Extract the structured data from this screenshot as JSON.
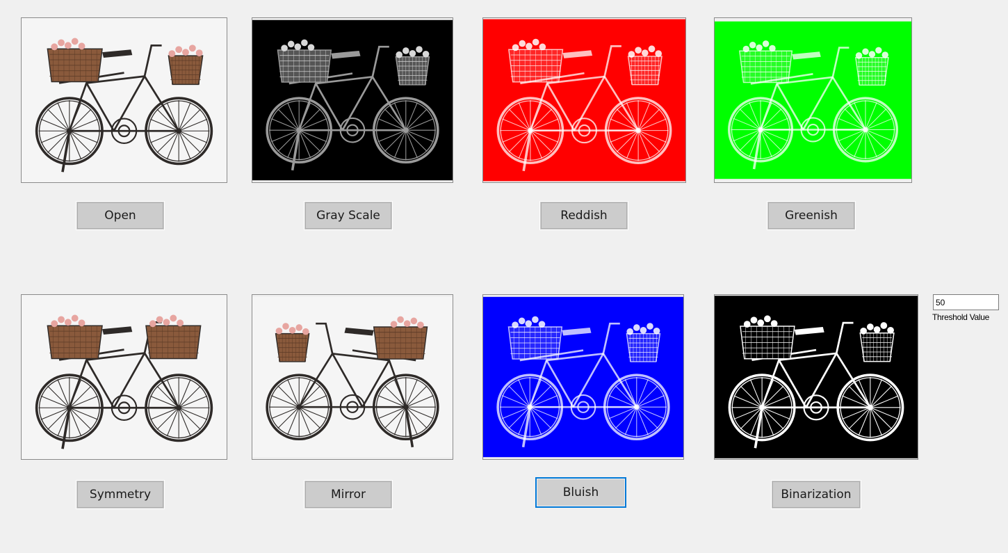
{
  "images": [
    {
      "name": "original",
      "filter": "original",
      "bg": "#f5f5f5"
    },
    {
      "name": "grayscale",
      "filter": "grayscale",
      "bg": "#000000"
    },
    {
      "name": "reddish",
      "filter": "tint",
      "bg": "#ff0000"
    },
    {
      "name": "greenish",
      "filter": "tint",
      "bg": "#00ff00"
    },
    {
      "name": "symmetry",
      "filter": "symmetry",
      "bg": "#f5f5f5"
    },
    {
      "name": "mirror",
      "filter": "mirror",
      "bg": "#f5f5f5"
    },
    {
      "name": "bluish",
      "filter": "tint",
      "bg": "#0000ff"
    },
    {
      "name": "binarization",
      "filter": "binary",
      "bg": "#000000"
    }
  ],
  "buttons": {
    "open": "Open",
    "gray_scale": "Gray Scale",
    "reddish": "Reddish",
    "greenish": "Greenish",
    "symmetry": "Symmetry",
    "mirror": "Mirror",
    "bluish": "Bluish",
    "binarization": "Binarization"
  },
  "threshold": {
    "value": "50",
    "label": "Threshold Value"
  },
  "focused_button": "bluish",
  "colors": {
    "window_bg": "#f0f0f0",
    "button_bg": "#cccccc",
    "focus_accent": "#0078d7",
    "metal": "#2e2a28",
    "basket": "#8a5a3c",
    "flowers": "#e7a5a0"
  }
}
